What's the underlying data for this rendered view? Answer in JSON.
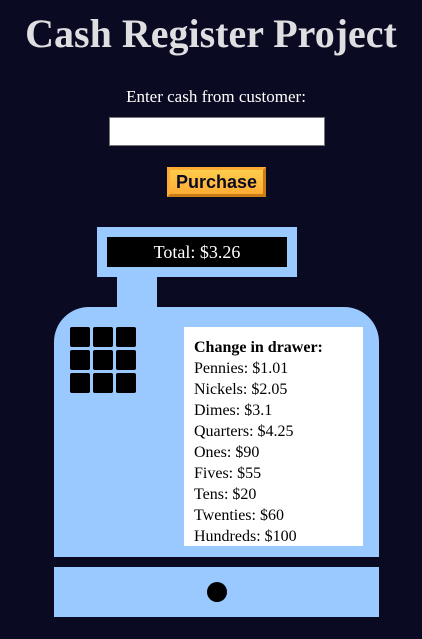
{
  "page": {
    "title": "Cash Register Project"
  },
  "form": {
    "prompt_label": "Enter cash from customer:",
    "cash_input_value": "",
    "cash_input_placeholder": "",
    "purchase_label": "Purchase"
  },
  "register": {
    "total_text": "Total: $3.26",
    "drawer_title": "Change in drawer:",
    "drawer": [
      {
        "label": "Pennies: $1.01"
      },
      {
        "label": "Nickels: $2.05"
      },
      {
        "label": "Dimes: $3.1"
      },
      {
        "label": "Quarters: $4.25"
      },
      {
        "label": "Ones: $90"
      },
      {
        "label": "Fives: $55"
      },
      {
        "label": "Tens: $20"
      },
      {
        "label": "Twenties: $60"
      },
      {
        "label": "Hundreds: $100"
      }
    ]
  },
  "colors": {
    "background": "#0a0a23",
    "register": "#99c9ff",
    "button": "#feac32"
  }
}
